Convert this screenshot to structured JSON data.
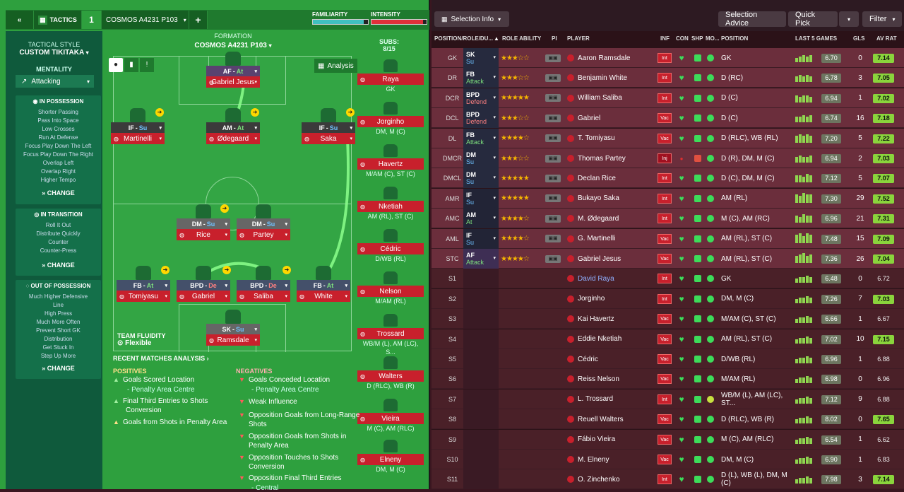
{
  "topbar": {
    "back": "«",
    "tactics": "TACTICS",
    "slot": "1",
    "tactic_name": "COSMOS A4231 P103",
    "add": "+",
    "familiarity_label": "FAMILIARITY",
    "intensity_label": "INTENSITY"
  },
  "sidebar": {
    "style_label": "TACTICAL STYLE",
    "style_value": "CUSTOM TIKITAKA",
    "mentality_label": "MENTALITY",
    "mentality_value": "Attacking",
    "in_possession": {
      "title": "IN POSSESSION",
      "items": [
        "Shorter Passing",
        "Pass Into Space",
        "Low Crosses",
        "Run At Defense",
        "Focus Play Down The Left",
        "Focus Play Down The Right",
        "Overlap Left",
        "Overlap Right",
        "Higher Tempo"
      ],
      "change": "CHANGE"
    },
    "in_transition": {
      "title": "IN TRANSITION",
      "items": [
        "Roll It Out",
        "Distribute Quickly",
        "Counter",
        "Counter-Press"
      ],
      "change": "CHANGE"
    },
    "out_of_possession": {
      "title": "OUT OF POSSESSION",
      "items": [
        "Much Higher Defensive",
        "Line",
        "High Press",
        "Much More Often",
        "Prevent Short GK",
        "Distribution",
        "Get Stuck In",
        "Step Up More"
      ],
      "change": "CHANGE"
    }
  },
  "formation": {
    "label": "FORMATION",
    "name": "COSMOS A4231 P103",
    "analysis_btn": "Analysis",
    "team_fluidity_label": "TEAM FLUIDITY",
    "team_fluidity_value": "Flexible"
  },
  "players": [
    {
      "role": "AF",
      "duty": "At",
      "name": "Gabriel Jesus"
    },
    {
      "role": "IF",
      "duty": "Su",
      "name": "Martinelli"
    },
    {
      "role": "AM",
      "duty": "At",
      "name": "Ødegaard"
    },
    {
      "role": "IF",
      "duty": "Su",
      "name": "Saka"
    },
    {
      "role": "DM",
      "duty": "Su",
      "name": "Rice"
    },
    {
      "role": "DM",
      "duty": "Su",
      "name": "Partey"
    },
    {
      "role": "FB",
      "duty": "At",
      "name": "Tomiyasu"
    },
    {
      "role": "BPD",
      "duty": "De",
      "name": "Gabriel"
    },
    {
      "role": "BPD",
      "duty": "De",
      "name": "Saliba"
    },
    {
      "role": "FB",
      "duty": "At",
      "name": "White"
    },
    {
      "role": "SK",
      "duty": "Su",
      "name": "Ramsdale"
    }
  ],
  "subs": {
    "label": "SUBS:",
    "count": "8/15",
    "list": [
      {
        "name": "Raya",
        "pos": "GK"
      },
      {
        "name": "Jorginho",
        "pos": "DM, M (C)"
      },
      {
        "name": "Havertz",
        "pos": "M/AM (C), ST (C)"
      },
      {
        "name": "Nketiah",
        "pos": "AM (RL), ST (C)"
      },
      {
        "name": "Cédric",
        "pos": "D/WB (RL)"
      },
      {
        "name": "Nelson",
        "pos": "M/AM (RL)"
      },
      {
        "name": "Trossard",
        "pos": "WB/M (L), AM (LC), S..."
      },
      {
        "name": "Walters",
        "pos": "D (RLC), WB (R)"
      },
      {
        "name": "Vieira",
        "pos": "M (C), AM (RLC)"
      },
      {
        "name": "Elneny",
        "pos": "DM, M (C)"
      }
    ]
  },
  "analysis": {
    "title": "RECENT MATCHES ANALYSIS ›",
    "positives_label": "POSITIVES",
    "negatives_label": "NEGATIVES",
    "positives": [
      "Goals Scored Location",
      "- Penalty Area Centre",
      "Final Third Entries to Shots",
      "Conversion",
      "Goals from Shots in Penalty Area"
    ],
    "negatives": [
      "Goals Conceded Location",
      "- Penalty Area Centre",
      "Weak Influence",
      "Opposition Goals from Long-Range",
      "Shots",
      "Opposition Goals from Shots in",
      "Penalty Area",
      "Opposition Touches to Shots",
      "Conversion",
      "Opposition Final Third Entries",
      "- Central"
    ]
  },
  "right_top": {
    "selection_info": "Selection Info",
    "selection_advice": "Selection Advice",
    "quick_pick": "Quick Pick",
    "filter": "Filter"
  },
  "table_headers": {
    "pos": "POSITION/ROLE/DU...",
    "role_ability": "ROLE ABILITY",
    "pi": "PI",
    "player": "PLAYER",
    "inf": "INF",
    "con": "CON",
    "shp": "SHP",
    "mo": "MO...",
    "position": "POSITION",
    "last5": "LAST 5 GAMES",
    "gls": "GLS",
    "avrat": "AV RAT"
  },
  "rows": [
    {
      "pos": "GK",
      "role": "SK",
      "duty": "Su",
      "stars": "★★★☆☆",
      "player": "Aaron Ramsdale",
      "inf": "Int",
      "position": "GK",
      "avg": "6.70",
      "gls": "0",
      "avrat": "7.14"
    },
    {
      "pos": "DR",
      "role": "FB",
      "duty": "Attack",
      "stars": "★★★☆☆",
      "player": "Benjamin White",
      "inf": "Int",
      "position": "D (RC)",
      "avg": "6.78",
      "gls": "3",
      "avrat": "7.05"
    },
    {
      "pos": "DCR",
      "role": "BPD",
      "duty": "Defend",
      "stars": "★★★★★",
      "player": "William Saliba",
      "inf": "Int",
      "position": "D (C)",
      "avg": "6.94",
      "gls": "1",
      "avrat": "7.02"
    },
    {
      "pos": "DCL",
      "role": "BPD",
      "duty": "Defend",
      "stars": "★★★☆☆",
      "player": "Gabriel",
      "inf": "Vac",
      "position": "D (C)",
      "avg": "6.74",
      "gls": "16",
      "avrat": "7.18"
    },
    {
      "pos": "DL",
      "role": "FB",
      "duty": "Attack",
      "stars": "★★★★☆",
      "player": "T. Tomiyasu",
      "inf": "Vac",
      "position": "D (RLC), WB (RL)",
      "avg": "7.20",
      "gls": "5",
      "avrat": "7.22"
    },
    {
      "pos": "DMCR",
      "role": "DM",
      "duty": "Su",
      "stars": "★★★☆☆",
      "player": "Thomas Partey",
      "inf": "Inj",
      "position": "D (R), DM, M (C)",
      "avg": "6.94",
      "gls": "2",
      "avrat": "7.03"
    },
    {
      "pos": "DMCL",
      "role": "DM",
      "duty": "Su",
      "stars": "★★★★★",
      "player": "Declan Rice",
      "inf": "Int",
      "position": "D (C), DM, M (C)",
      "avg": "7.12",
      "gls": "5",
      "avrat": "7.07"
    },
    {
      "pos": "AMR",
      "role": "IF",
      "duty": "Su",
      "stars": "★★★★★",
      "player": "Bukayo Saka",
      "inf": "Int",
      "position": "AM (RL)",
      "avg": "7.30",
      "gls": "29",
      "avrat": "7.52"
    },
    {
      "pos": "AMC",
      "role": "AM",
      "duty": "At",
      "stars": "★★★★☆",
      "player": "M. Ødegaard",
      "inf": "Int",
      "position": "M (C), AM (RC)",
      "avg": "6.96",
      "gls": "21",
      "avrat": "7.31"
    },
    {
      "pos": "AML",
      "role": "IF",
      "duty": "Su",
      "stars": "★★★★☆",
      "player": "G. Martinelli",
      "inf": "Vac",
      "position": "AM (RL), ST (C)",
      "avg": "7.48",
      "gls": "15",
      "avrat": "7.09"
    },
    {
      "pos": "STC",
      "role": "AF",
      "duty": "Attack",
      "stars": "★★★★☆",
      "player": "Gabriel Jesus",
      "inf": "Vac",
      "position": "AM (RL), ST (C)",
      "avg": "7.36",
      "gls": "26",
      "avrat": "7.04"
    },
    {
      "pos": "S1",
      "role": "",
      "duty": "",
      "stars": "",
      "player": "David Raya",
      "inf": "Int",
      "position": "GK",
      "avg": "6.48",
      "gls": "0",
      "avrat": "6.72"
    },
    {
      "pos": "S2",
      "role": "",
      "duty": "",
      "stars": "",
      "player": "Jorginho",
      "inf": "Int",
      "position": "DM, M (C)",
      "avg": "7.26",
      "gls": "7",
      "avrat": "7.03"
    },
    {
      "pos": "S3",
      "role": "",
      "duty": "",
      "stars": "",
      "player": "Kai Havertz",
      "inf": "Vac",
      "position": "M/AM (C), ST (C)",
      "avg": "6.66",
      "gls": "1",
      "avrat": "6.67"
    },
    {
      "pos": "S4",
      "role": "",
      "duty": "",
      "stars": "",
      "player": "Eddie Nketiah",
      "inf": "Vac",
      "position": "AM (RL), ST (C)",
      "avg": "7.02",
      "gls": "10",
      "avrat": "7.15"
    },
    {
      "pos": "S5",
      "role": "",
      "duty": "",
      "stars": "",
      "player": "Cédric",
      "inf": "Vac",
      "position": "D/WB (RL)",
      "avg": "6.96",
      "gls": "1",
      "avrat": "6.88"
    },
    {
      "pos": "S6",
      "role": "",
      "duty": "",
      "stars": "",
      "player": "Reiss Nelson",
      "inf": "Vac",
      "position": "M/AM (RL)",
      "avg": "6.98",
      "gls": "0",
      "avrat": "6.96"
    },
    {
      "pos": "S7",
      "role": "",
      "duty": "",
      "stars": "",
      "player": "L. Trossard",
      "inf": "Int",
      "position": "WB/M (L), AM (LC), ST...",
      "avg": "7.12",
      "gls": "9",
      "avrat": "6.88"
    },
    {
      "pos": "S8",
      "role": "",
      "duty": "",
      "stars": "",
      "player": "Reuell Walters",
      "inf": "Vac",
      "position": "D (RLC), WB (R)",
      "avg": "8.02",
      "gls": "0",
      "avrat": "7.65"
    },
    {
      "pos": "S9",
      "role": "",
      "duty": "",
      "stars": "",
      "player": "Fábio Vieira",
      "inf": "Vac",
      "position": "M (C), AM (RLC)",
      "avg": "6.54",
      "gls": "1",
      "avrat": "6.62"
    },
    {
      "pos": "S10",
      "role": "",
      "duty": "",
      "stars": "",
      "player": "M. Elneny",
      "inf": "Vac",
      "position": "DM, M (C)",
      "avg": "6.90",
      "gls": "1",
      "avrat": "6.83"
    },
    {
      "pos": "S11",
      "role": "",
      "duty": "",
      "stars": "",
      "player": "O. Zinchenko",
      "inf": "Int",
      "position": "D (L), WB (L), DM, M (C)",
      "avg": "7.98",
      "gls": "3",
      "avrat": "7.14"
    }
  ]
}
